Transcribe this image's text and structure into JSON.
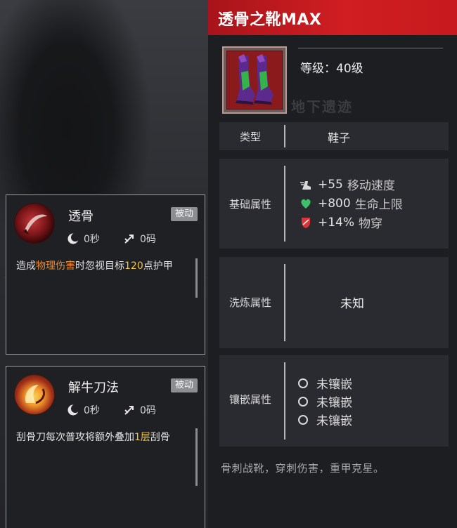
{
  "skills": [
    {
      "name": "透骨",
      "badge": "被动",
      "cooldown": "0秒",
      "range": "0码",
      "desc": [
        {
          "text": "造成",
          "style": "normal"
        },
        {
          "text": "物理伤害",
          "style": "orange"
        },
        {
          "text": "时忽视目标",
          "style": "normal"
        },
        {
          "text": "120",
          "style": "yellow"
        },
        {
          "text": "点护甲",
          "style": "normal"
        }
      ]
    },
    {
      "name": "解牛刀法",
      "badge": "被动",
      "cooldown": "0秒",
      "range": "0码",
      "desc": [
        {
          "text": "刮骨刀每次普攻将额外叠加",
          "style": "normal"
        },
        {
          "text": "1层",
          "style": "yellow"
        },
        {
          "text": "刮骨",
          "style": "normal"
        }
      ]
    }
  ],
  "item": {
    "title": "透骨之靴MAX",
    "level": "等级：40级",
    "background_text": "地下遗迹",
    "type_label": "类型",
    "type_value": "鞋子",
    "base_label": "基础属性",
    "base_attrs": [
      {
        "icon": "boot-speed-icon",
        "value": "+55",
        "name": "移动速度"
      },
      {
        "icon": "heart-icon",
        "value": "+800",
        "name": "生命上限"
      },
      {
        "icon": "armor-pierce-icon",
        "value": "+14%",
        "name": "物穿"
      }
    ],
    "refine_label": "洗炼属性",
    "refine_value": "未知",
    "socket_label": "镶嵌属性",
    "sockets": [
      "未镶嵌",
      "未镶嵌",
      "未镶嵌"
    ],
    "flavor": "骨刺战靴，穿刺伤害，重甲克星。"
  },
  "colors": {
    "header_red": "#c71a1e",
    "highlight_orange": "#ec8b2c",
    "highlight_yellow": "#f0c53a",
    "heart_green": "#3ec06a"
  }
}
